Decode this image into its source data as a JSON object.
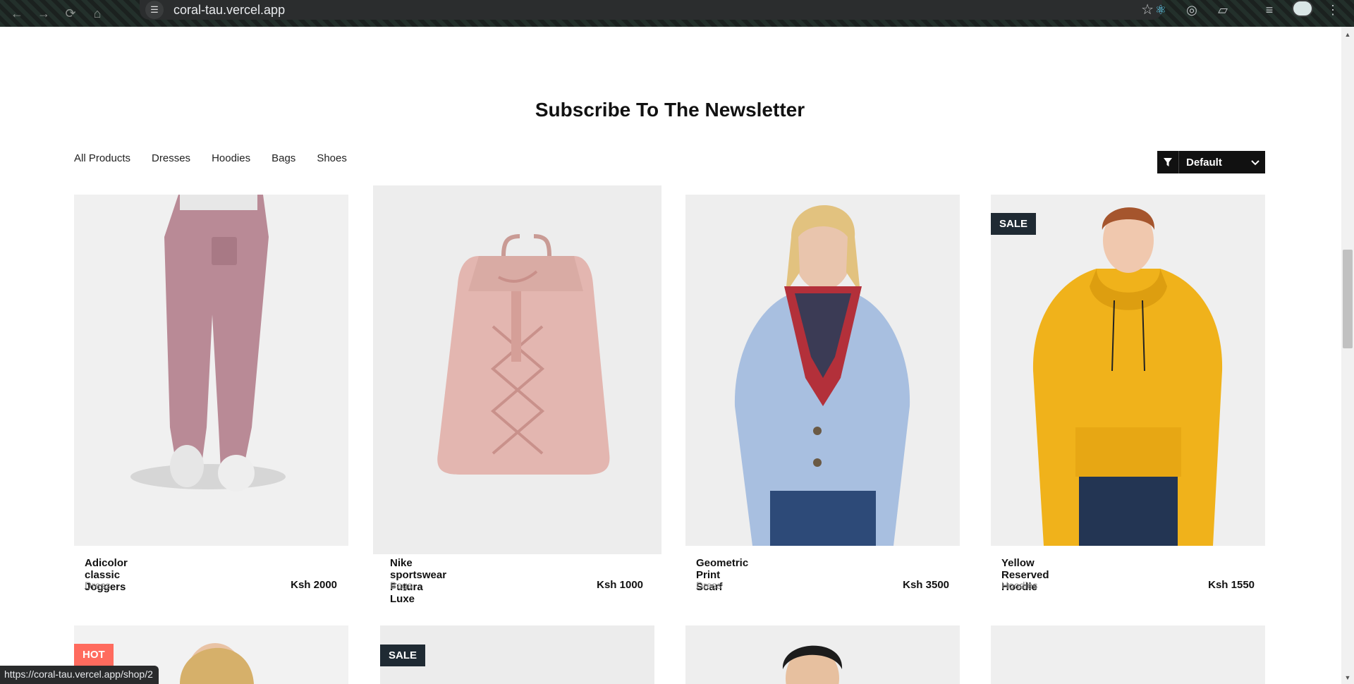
{
  "browser": {
    "url": "coral-tau.vercel.app",
    "status_url": "https://coral-tau.vercel.app/shop/2"
  },
  "section": {
    "title": "Subscribe To The Newsletter"
  },
  "filters": [
    "All Products",
    "Dresses",
    "Hoodies",
    "Bags",
    "Shoes"
  ],
  "sort": {
    "value": "Default"
  },
  "products": [
    {
      "name": "Adicolor classic Joggers",
      "category": "Dress",
      "price": "Ksh 2000",
      "badge": ""
    },
    {
      "name": "Nike sportswear Futura Luxe",
      "category": "Bags",
      "price": "Ksh 1000",
      "badge": ""
    },
    {
      "name": "Geometric Print Scarf",
      "category": "Dress",
      "price": "Ksh 3500",
      "badge": ""
    },
    {
      "name": "Yellow Reserved Hoodie",
      "category": "Hoodies",
      "price": "Ksh 1550",
      "badge": "SALE"
    }
  ],
  "row2_badges": {
    "first": "HOT",
    "second": "SALE"
  },
  "colors": {
    "sale_badge": "#1f2a33",
    "hot_badge": "#ff6b5e",
    "sort_bg": "#111111"
  }
}
